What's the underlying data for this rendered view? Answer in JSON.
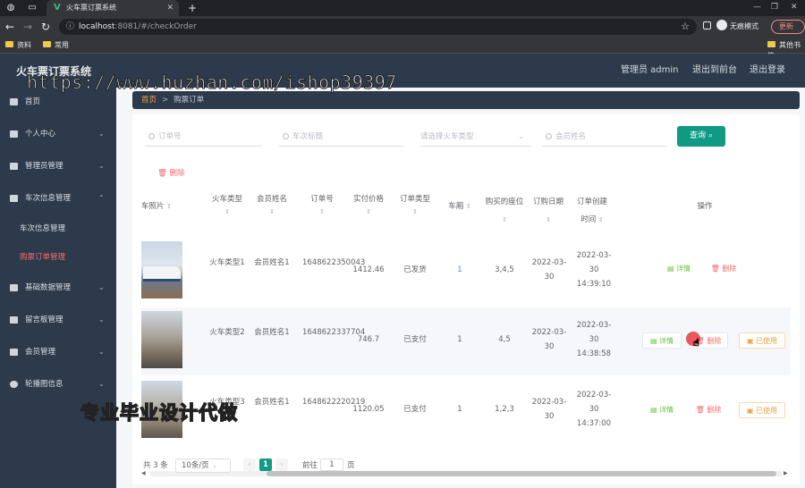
{
  "browser": {
    "tab_title": "火车票订票系统",
    "url_host": "localhost",
    "url_rest": ":8081/#/checkOrder",
    "incognito_label": "无痕模式",
    "update_label": "更新",
    "bookmarks": [
      "资料",
      "常用",
      "其他书签"
    ]
  },
  "header": {
    "title": "火车票订票系统",
    "admin_label": "管理员 admin",
    "back_label": "退出到前台",
    "logout_label": "退出登录"
  },
  "watermarks": {
    "top": "https://www.huzhan.com/ishop39397",
    "bottom": "专业毕业设计代做"
  },
  "sidebar": {
    "items": [
      {
        "label": "首页",
        "icon": "home-icon"
      },
      {
        "label": "个人中心",
        "icon": "user-icon"
      },
      {
        "label": "管理员管理",
        "icon": "admin-icon"
      },
      {
        "label": "车次信息管理",
        "icon": "train-icon"
      },
      {
        "label": "基础数据管理",
        "icon": "data-icon"
      },
      {
        "label": "留言板管理",
        "icon": "message-icon"
      },
      {
        "label": "会员管理",
        "icon": "member-icon"
      },
      {
        "label": "轮播图信息",
        "icon": "carousel-icon"
      }
    ],
    "subs": [
      "车次信息管理",
      "购票订单管理"
    ]
  },
  "breadcrumb": {
    "home": "首页",
    "sep": ">",
    "current": "购票订单"
  },
  "search": {
    "order_no_placeholder": "订单号",
    "train_name_placeholder": "车次标题",
    "train_type_placeholder": "请选择火车类型",
    "member_name_placeholder": "会员姓名",
    "query_label": "查询",
    "delete_label": "删除"
  },
  "table": {
    "headers": [
      "车照片",
      "火车类型",
      "会员姓名",
      "订单号",
      "实付价格",
      "订单类型",
      "车厢",
      "购买的座位",
      "订购日期",
      "订单创建时间",
      "操作"
    ],
    "rows": [
      {
        "type": "火车类型1",
        "member": "会员姓名1",
        "order": "1648622350043",
        "price": "1412.46",
        "status": "已发货",
        "car": "1",
        "seats": "3,4,5",
        "date": "2022-03-30",
        "created": "2022-03-30 14:39:10",
        "actions": [
          "详情",
          "删除"
        ]
      },
      {
        "type": "火车类型2",
        "member": "会员姓名1",
        "order": "1648622337704",
        "price": "746.7",
        "status": "已支付",
        "car": "1",
        "seats": "4,5",
        "date": "2022-03-30",
        "created": "2022-03-30 14:38:58",
        "actions": [
          "详情",
          "删除",
          "已使用"
        ]
      },
      {
        "type": "火车类型3",
        "member": "会员姓名1",
        "order": "1648622220219",
        "price": "1120.05",
        "status": "已支付",
        "car": "1",
        "seats": "1,2,3",
        "date": "2022-03-30",
        "created": "2022-03-30 14:37:00",
        "actions": [
          "详情",
          "删除",
          "已使用"
        ]
      }
    ]
  },
  "pagination": {
    "total": "共 3 条",
    "page_size": "10条/页",
    "current": "1",
    "goto_label": "前往",
    "goto_value": "1",
    "page_unit": "页"
  }
}
